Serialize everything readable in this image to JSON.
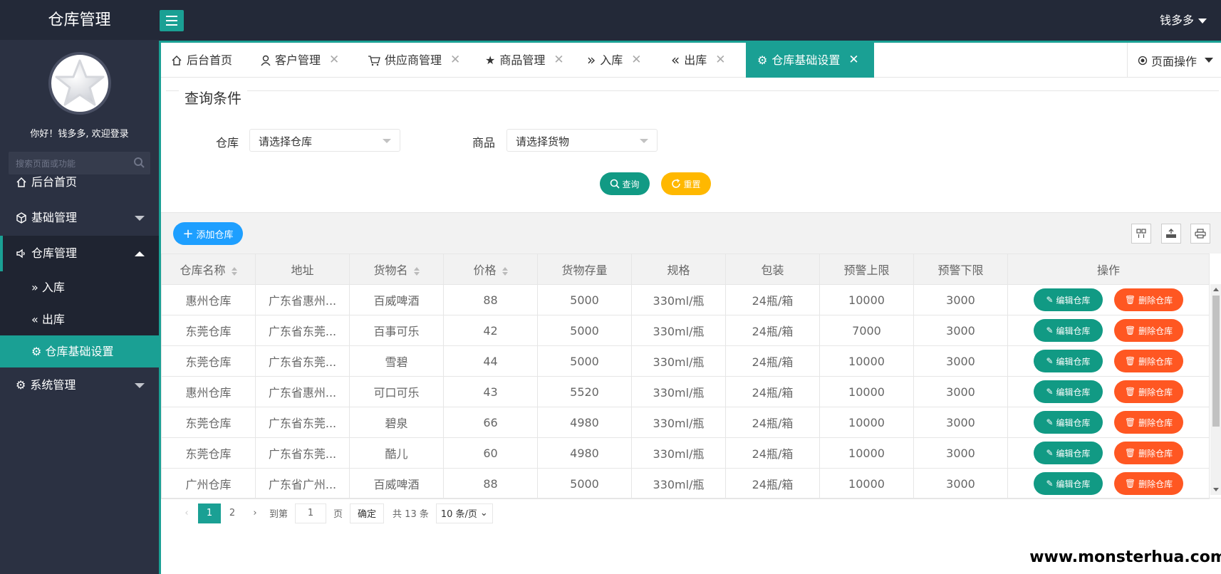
{
  "app": {
    "title": "仓库管理",
    "user": "钱多多"
  },
  "sidebar": {
    "welcome": "你好！钱多多, 欢迎登录",
    "search_placeholder": "搜索页面或功能",
    "items": [
      {
        "label": "后台首页",
        "icon": "home-icon"
      },
      {
        "label": "基础管理",
        "icon": "cube-icon"
      },
      {
        "label": "仓库管理",
        "icon": "speaker-icon"
      },
      {
        "label": "系统管理",
        "icon": "gear-icon"
      }
    ],
    "sub_items": [
      {
        "label": "入库",
        "icon": "double-right-icon"
      },
      {
        "label": "出库",
        "icon": "double-left-icon"
      },
      {
        "label": "仓库基础设置",
        "icon": "gear-icon"
      }
    ]
  },
  "tabs": [
    {
      "label": "后台首页",
      "icon": "home-icon"
    },
    {
      "label": "客户管理",
      "icon": "user-icon"
    },
    {
      "label": "供应商管理",
      "icon": "cart-icon"
    },
    {
      "label": "商品管理",
      "icon": "star-icon"
    },
    {
      "label": "入库",
      "icon": "double-right-icon"
    },
    {
      "label": "出库",
      "icon": "double-left-icon"
    },
    {
      "label": "仓库基础设置",
      "icon": "gear-icon",
      "active": true
    }
  ],
  "page_ops": "页面操作",
  "query": {
    "legend": "查询条件",
    "warehouse_label": "仓库",
    "warehouse_placeholder": "请选择仓库",
    "goods_label": "商品",
    "goods_placeholder": "请选择货物",
    "search_btn": "查询",
    "reset_btn": "重置"
  },
  "toolbar": {
    "add_btn": "添加仓库"
  },
  "table": {
    "headers": [
      "仓库名称",
      "地址",
      "货物名",
      "价格",
      "货物存量",
      "规格",
      "包装",
      "预警上限",
      "预警下限",
      "操作"
    ],
    "rows": [
      [
        "惠州仓库",
        "广东省惠州...",
        "百威啤酒",
        "88",
        "5000",
        "330ml/瓶",
        "24瓶/箱",
        "10000",
        "3000"
      ],
      [
        "东莞仓库",
        "广东省东莞...",
        "百事可乐",
        "42",
        "5000",
        "330ml/瓶",
        "24瓶/箱",
        "7000",
        "3000"
      ],
      [
        "东莞仓库",
        "广东省东莞...",
        "雪碧",
        "44",
        "5000",
        "330ml/瓶",
        "24瓶/箱",
        "10000",
        "3000"
      ],
      [
        "惠州仓库",
        "广东省惠州...",
        "可口可乐",
        "43",
        "5520",
        "330ml/瓶",
        "24瓶/箱",
        "10000",
        "3000"
      ],
      [
        "东莞仓库",
        "广东省东莞...",
        "碧泉",
        "66",
        "4980",
        "330ml/瓶",
        "24瓶/箱",
        "10000",
        "3000"
      ],
      [
        "东莞仓库",
        "广东省东莞...",
        "酷儿",
        "60",
        "4980",
        "330ml/瓶",
        "24瓶/箱",
        "10000",
        "3000"
      ],
      [
        "广州仓库",
        "广东省广州...",
        "百威啤酒",
        "88",
        "5000",
        "330ml/瓶",
        "24瓶/箱",
        "10000",
        "3000"
      ]
    ],
    "edit_btn": "编辑仓库",
    "delete_btn": "删除仓库"
  },
  "pager": {
    "pages": [
      "1",
      "2"
    ],
    "goto_label": "到第",
    "goto_value": "1",
    "page_unit": "页",
    "confirm": "确定",
    "total": "共 13 条",
    "limit": "10 条/页"
  },
  "watermark": "www.monsterhua.com",
  "colors": {
    "accent": "#1aa094",
    "sidebar": "#2b3142",
    "topbar": "#232938",
    "danger": "#ff5722",
    "blue": "#1e9fff",
    "yellow": "#ffb800"
  }
}
